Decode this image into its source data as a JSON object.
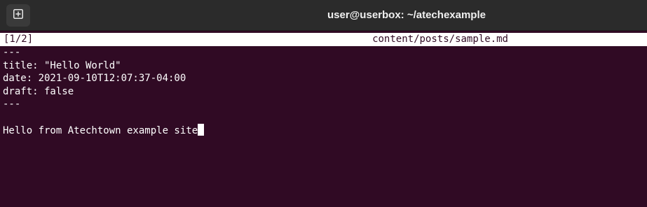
{
  "window": {
    "title": "user@userbox: ~/atechexample"
  },
  "icons": {
    "new_tab": "new-tab-icon"
  },
  "editor": {
    "buffer_indicator": "[1/2]",
    "filename": "content/posts/sample.md",
    "lines": [
      "---",
      "title: \"Hello World\"",
      "date: 2021-09-10T12:07:37-04:00",
      "draft: false",
      "---",
      "",
      "Hello from Atechtown example site"
    ]
  },
  "colors": {
    "terminal_background": "#300a24",
    "titlebar_background": "#2b2b2b",
    "text": "#ffffff"
  }
}
